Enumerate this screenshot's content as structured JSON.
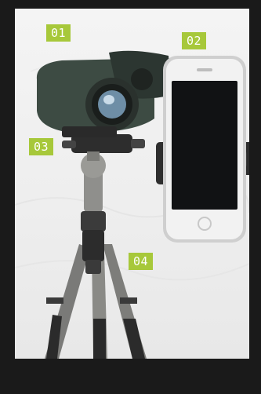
{
  "labels": {
    "binoculars": "01",
    "phone_adapter": "02",
    "tripod_head": "03",
    "tripod_legs": "04"
  },
  "colors": {
    "label_bg": "#a7c83a",
    "frame_bg": "#1a1a1a"
  }
}
